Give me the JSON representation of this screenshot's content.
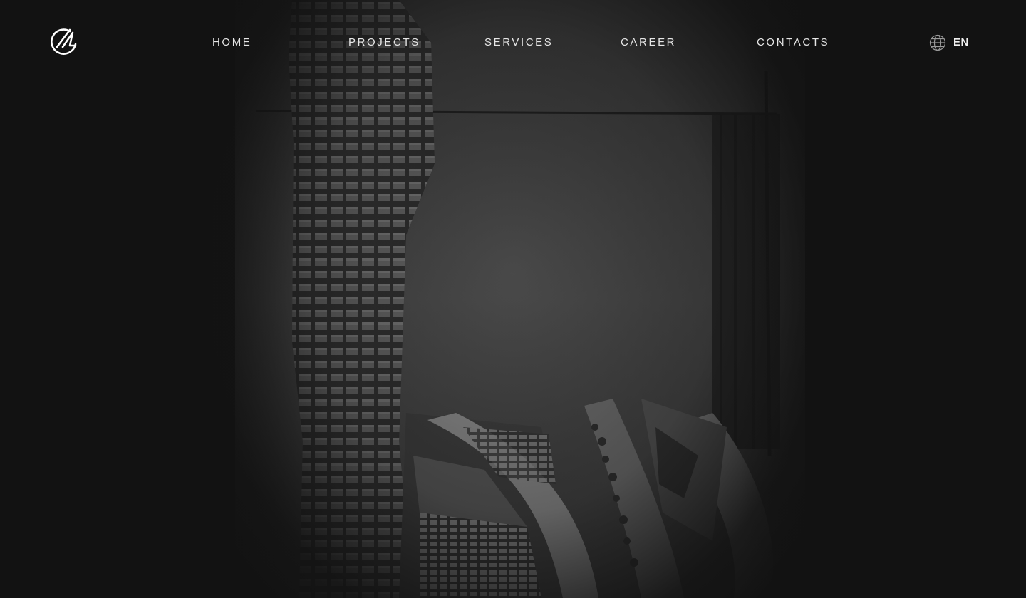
{
  "brand": {
    "logo_icon": "monogram-logo-icon"
  },
  "nav": {
    "items": [
      {
        "label": "HOME"
      },
      {
        "label": "PROJECTS"
      },
      {
        "label": "SERVICES"
      },
      {
        "label": "CAREER"
      },
      {
        "label": "CONTACTS"
      }
    ]
  },
  "language": {
    "icon": "globe-icon",
    "current": "EN"
  },
  "hero": {
    "image": "architectural-model-photo",
    "tone": "grayscale"
  },
  "colors": {
    "background": "#121212",
    "nav_text": "#e6e6e6",
    "accent": "#ffffff"
  }
}
